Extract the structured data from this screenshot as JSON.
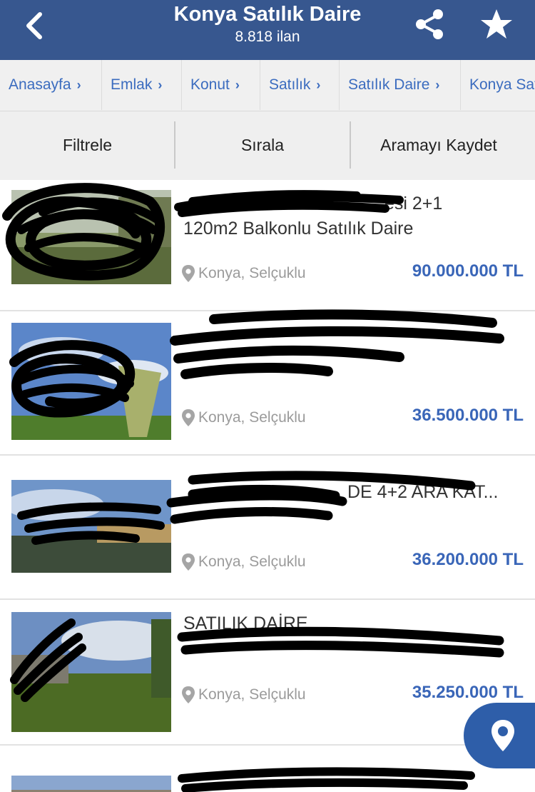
{
  "header": {
    "title": "Konya Satılık Daire",
    "subtitle": "8.818 ilan"
  },
  "breadcrumb": [
    "Anasayfa",
    "Emlak",
    "Konut",
    "Satılık",
    "Satılık Daire",
    "Konya Satılık Daire"
  ],
  "toolbar": {
    "filter_label": "Filtrele",
    "sort_label": "Sırala",
    "save_search_label": "Aramayı Kaydet"
  },
  "listings": [
    {
      "title_line1": "esi 2+1",
      "title_line2": "120m2 Balkonlu Satılık Daire",
      "location": "Konya, Selçuklu",
      "price": "90.000.000 TL"
    },
    {
      "title_line1": "",
      "title_line2": "",
      "location": "Konya, Selçuklu",
      "price": "36.500.000 TL"
    },
    {
      "title_line1": "",
      "title_line2": "DE 4+2 ARA KAT...",
      "location": "Konya, Selçuklu",
      "price": "36.200.000 TL"
    },
    {
      "title_line1": "",
      "title_line2": "SATILIK DAİRE",
      "location": "Konya, Selçuklu",
      "price": "35.250.000 TL"
    },
    {
      "title_line1": "",
      "title_line2": "",
      "location": "",
      "price": ""
    }
  ],
  "colors": {
    "header_bg": "#37578f",
    "link_blue": "#3b6cbf",
    "price_blue": "#3a66b8",
    "fab_bg": "#2e5ea9"
  },
  "icons": {
    "back": "chevron-left-icon",
    "share": "share-icon",
    "favorite": "star-icon",
    "location": "location-pin-icon",
    "map": "map-pin-icon"
  }
}
